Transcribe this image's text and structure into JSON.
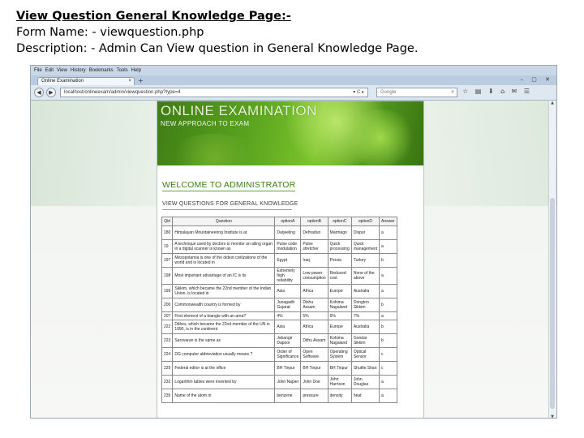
{
  "header": {
    "title": "View Question General Knowledge Page:-",
    "form_name": "Form Name: - viewquestion.php",
    "description": "Description: - Admin Can View question in General Knowledge Page."
  },
  "browser": {
    "menu": [
      "File",
      "Edit",
      "View",
      "History",
      "Bookmarks",
      "Tools",
      "Help"
    ],
    "tab_title": "Online Examination",
    "tab_close": "×",
    "new_tab": "+",
    "window_controls": "– ▢ ✕",
    "back": "◀",
    "forward": "▶",
    "url": "localhost/onlineexam/admin/viewquestion.php?type=4",
    "url_icons": "▾ C ▸",
    "search_placeholder": "Google",
    "search_icon": "⌕",
    "toolbar_icons": "☆ ▤ ⬇ ⌂ ✉ ☰",
    "scroll_up": "▲",
    "scroll_down": "▼"
  },
  "site": {
    "title": "ONLINE EXAMINATION",
    "subtitle": "NEW APPROACH TO EXAM",
    "welcome": "WELCOME TO ADMINISTRATOR",
    "section": "VIEW QUESTIONS FOR GENERAL KNOWLEDGE"
  },
  "table": {
    "columns": [
      "Qid",
      "Question",
      "optionA",
      "optionB",
      "optionC",
      "optionD",
      "Answer"
    ],
    "rows": [
      [
        "180",
        "Himalayan Mountaineering Institute is at",
        "Darjeeling",
        "Dehradun",
        "Marmago",
        "Dispur",
        "a"
      ],
      [
        "19",
        "A technique used by doctors to monitor an ailing organ in a digital scanner is known as",
        "Pulse code modulation",
        "Pulse stretcher",
        "Quick processing",
        "Quick management",
        "a"
      ],
      [
        "197",
        "Mesopotamia is one of the oldest civilizations of the world and is located in",
        "Egypt",
        "Iraq",
        "Persia",
        "Turkey",
        "b"
      ],
      [
        "198",
        "Most important advantage of an IC is its",
        "Extremely high reliability",
        "Low power consumption",
        "Reduced cost",
        "None of the above",
        "a"
      ],
      [
        "199",
        "Sikkim, which became the 22nd member of the Indian Union, is located in",
        "Asia",
        "Africa",
        "Europe",
        "Australia",
        "a"
      ],
      [
        "200",
        "Commonwealth country is formed by",
        "Junagadh Gujarat",
        "Dishu Assam",
        "Kohima Nagaland",
        "Dongton Sikkim",
        "b"
      ],
      [
        "207",
        "First element of a triangle with an area?",
        "4%",
        "5%",
        "6%",
        "7%",
        "a"
      ],
      [
        "222",
        "Dithes, which became the 22nd member of the UN in 1990, is in the continent",
        "Asia",
        "Africa",
        "Europe",
        "Australia",
        "b"
      ],
      [
        "223",
        "Sarovaran is the same as",
        "Jahangir Dapoor",
        "Dithu Assam",
        "Kohima Nagaland",
        "Gondar Sikkim",
        "b"
      ],
      [
        "224",
        "DG computer abbreviation usually means ?",
        "Order of Significance",
        "Open Software",
        "Operating System",
        "Optical Sensor",
        "c"
      ],
      [
        "229",
        "Federal editor is at the office",
        "BH Tinpur",
        "BH Tinpur",
        "BH Tinpur",
        "Shuttle Shan",
        "c"
      ],
      [
        "232",
        "Logarithm tables were invented by",
        "John Napier",
        "John Doe",
        "John Harrison",
        "John Douglas",
        "a"
      ],
      [
        "235",
        "Name of the atom in",
        "benzene",
        "pressure",
        "density",
        "heat",
        "a"
      ]
    ]
  }
}
